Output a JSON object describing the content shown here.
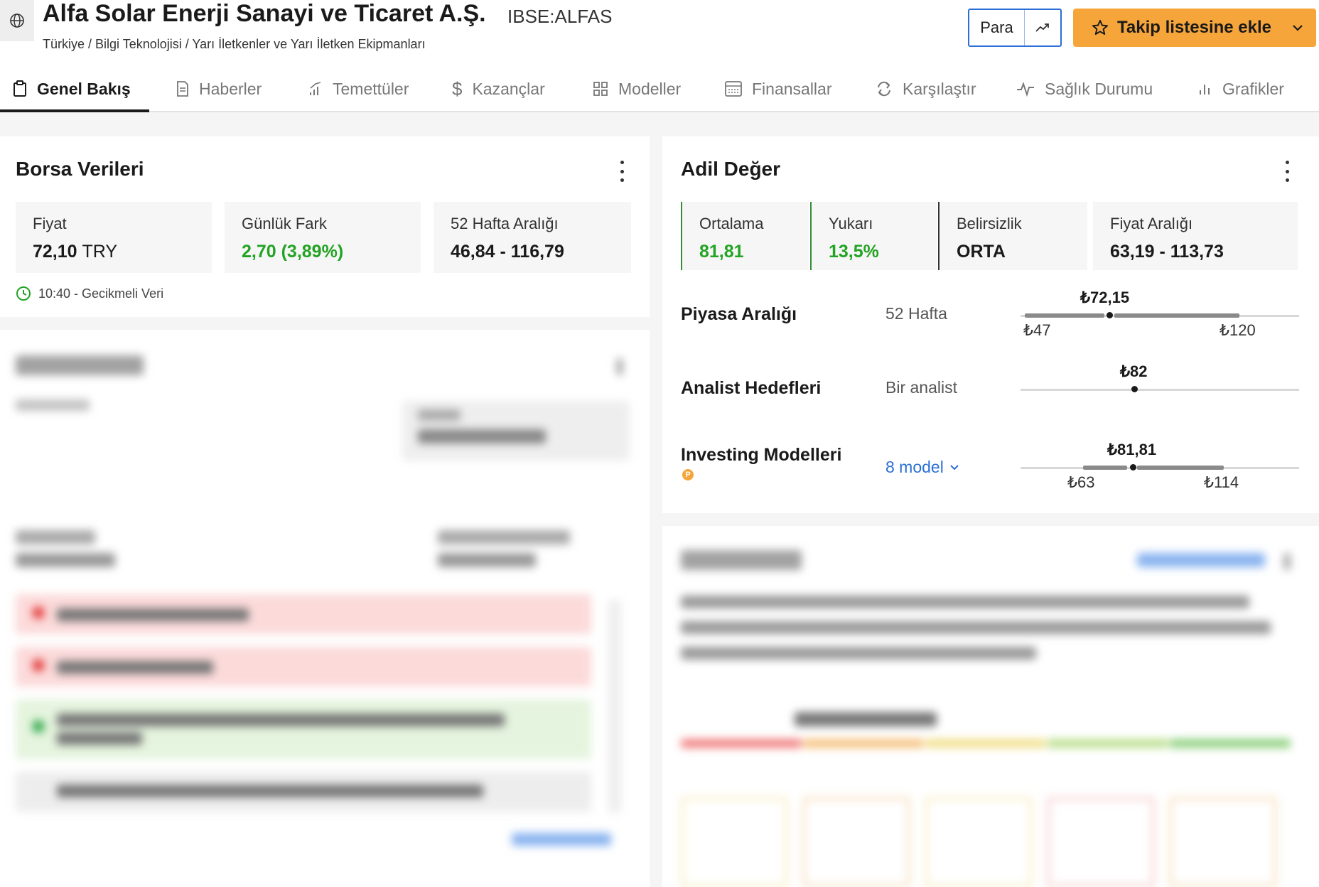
{
  "header": {
    "company_name": "Alfa Solar Enerji Sanayi ve Ticaret A.Ş.",
    "ticker": "IBSE:ALFAS",
    "breadcrumb": "Türkiye / Bilgi Teknolojisi / Yarı İletkenler ve Yarı İletken Ekipmanları",
    "currency_button": "Para",
    "watchlist_button": "Takip listesine ekle"
  },
  "tabs": [
    {
      "label": "Genel Bakış",
      "icon": "clipboard-icon",
      "active": true
    },
    {
      "label": "Haberler",
      "icon": "document-icon"
    },
    {
      "label": "Temettüler",
      "icon": "growth-icon"
    },
    {
      "label": "Kazançlar",
      "icon": "dollar-icon"
    },
    {
      "label": "Modeller",
      "icon": "grid-icon"
    },
    {
      "label": "Finansallar",
      "icon": "calculator-icon"
    },
    {
      "label": "Karşılaştır",
      "icon": "compare-icon"
    },
    {
      "label": "Sağlık Durumu",
      "icon": "pulse-icon"
    },
    {
      "label": "Grafikler",
      "icon": "bar-chart-icon"
    }
  ],
  "market_data": {
    "title": "Borsa Verileri",
    "price_label": "Fiyat",
    "price_value": "72,10",
    "price_unit": "TRY",
    "daily_change_label": "Günlük Fark",
    "daily_change_value": "2,70 (3,89%)",
    "week52_label": "52 Hafta Aralığı",
    "week52_value": "46,84 - 116,79",
    "delayed_text": "10:40 - Gecikmeli Veri"
  },
  "fair_value": {
    "title": "Adil Değer",
    "average_label": "Ortalama",
    "average_value": "81,81",
    "upside_label": "Yukarı",
    "upside_value": "13,5%",
    "uncertainty_label": "Belirsizlik",
    "uncertainty_value": "ORTA",
    "price_range_label": "Fiyat Aralığı",
    "price_range_value": "63,19 - 113,73",
    "market_range": {
      "label": "Piyasa Aralığı",
      "sub": "52 Hafta",
      "current": "₺72,15",
      "low": "₺47",
      "high": "₺120",
      "position": 0.36
    },
    "analyst_targets": {
      "label": "Analist Hedefleri",
      "sub": "Bir analist",
      "target": "₺82",
      "position": 0.42
    },
    "investing_models": {
      "label": "Investing Modelleri",
      "sub": "8 model",
      "value": "₺81,81",
      "low": "₺63",
      "high": "₺114",
      "position": 0.42
    }
  },
  "colors": {
    "accent_orange": "#f6a53b",
    "link_blue": "#2b6fd6",
    "positive_green": "#23a323"
  }
}
